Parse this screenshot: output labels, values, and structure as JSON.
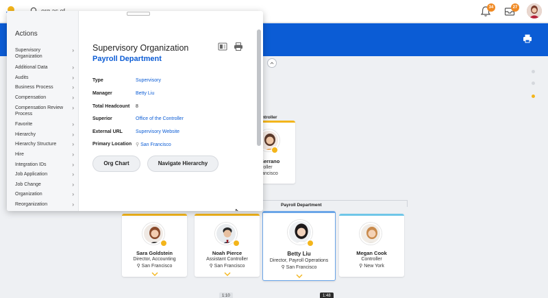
{
  "header": {
    "search_value": "org as of",
    "notifications_count": "34",
    "inbox_count": "27"
  },
  "popup": {
    "actions_title": "Actions",
    "actions": [
      "Supervisory Organization",
      "Additional Data",
      "Audits",
      "Business Process",
      "Compensation",
      "Compensation Review Process",
      "Favorite",
      "Hierarchy",
      "Hierarchy Structure",
      "Hire",
      "Integration IDs",
      "Job Application",
      "Job Change",
      "Organization",
      "Reorganization"
    ],
    "title": "Supervisory Organization",
    "subtitle": "Payroll Department",
    "fields": [
      {
        "label": "Type",
        "value": "Supervisory"
      },
      {
        "label": "Manager",
        "value": "Betty Liu"
      },
      {
        "label": "Total Headcount",
        "value": "8"
      },
      {
        "label": "Superior",
        "value": "Office of the Controller"
      },
      {
        "label": "External URL",
        "value": "Supervisory Website"
      },
      {
        "label": "Primary Location",
        "value": "San Francisco"
      }
    ],
    "buttons": {
      "org_chart": "Org Chart",
      "navigate": "Navigate Hierarchy"
    }
  },
  "chart": {
    "parent_header": "e Controller",
    "parent_card": {
      "name": "Serrano",
      "role": "roller",
      "location": "ancisco"
    },
    "department_label": "Payroll Department",
    "cards": [
      {
        "name": "Sara Goldstein",
        "role": "Director, Accounting",
        "location": "San Francisco"
      },
      {
        "name": "Noah Pierce",
        "role": "Assistant Controller",
        "location": "San Francisco"
      },
      {
        "name": "Betty Liu",
        "role": "Director, Payroll Operations",
        "location": "San Francisco"
      },
      {
        "name": "Megan Cook",
        "role": "Controller",
        "location": "New York"
      }
    ]
  },
  "video": {
    "elapsed": "1:10",
    "total": "1:48"
  },
  "colors": {
    "brand_blue": "#0b5cd5",
    "accent_yellow": "#f3b51b",
    "badge_orange": "#f08a24"
  }
}
